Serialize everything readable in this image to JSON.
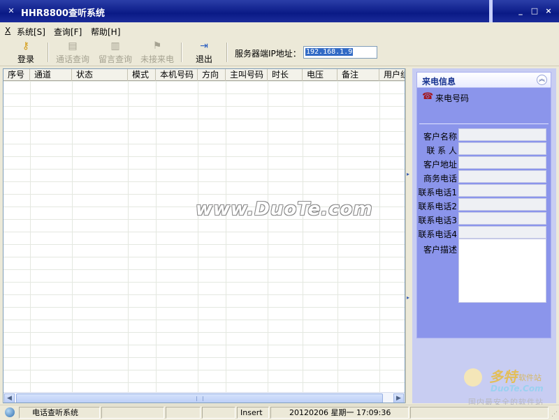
{
  "window": {
    "title": "HHR8800查听系统",
    "controls": {
      "minimize": "_",
      "maximize": "□",
      "close": "×"
    }
  },
  "menu": {
    "items": [
      {
        "label": "X"
      },
      {
        "label": "系统[S]"
      },
      {
        "label": "查询[F]"
      },
      {
        "label": "帮助[H]"
      }
    ]
  },
  "toolbar": {
    "login": "登录",
    "call_query": "通话查询",
    "message_query": "留言查询",
    "missed_calls": "未接来电",
    "exit": "退出",
    "server_ip_label": "服务器端IP地址：",
    "server_ip_value": "192.168.1.9"
  },
  "table": {
    "columns": [
      "序号",
      "通道",
      "状态",
      "模式",
      "本机号码",
      "方向",
      "主叫号码",
      "时长",
      "电压",
      "备注",
      "用户组"
    ]
  },
  "watermark": "www.DuoTe.com",
  "caller_panel": {
    "title": "来电信息",
    "caller_number_label": "来电号码",
    "fields": {
      "customer_name": "客户名称",
      "contact_person": "联 系 人",
      "customer_address": "客户地址",
      "business_phone": "商务电话",
      "contact_phone_1": "联系电话1",
      "contact_phone_2": "联系电话2",
      "contact_phone_3": "联系电话3",
      "contact_phone_4": "联系电话4",
      "customer_description": "客户描述"
    }
  },
  "logo": {
    "brand": "多特",
    "suffix": "软件站",
    "domain": "DuoTe.Com",
    "tagline": "国内最安全的软件站"
  },
  "statusbar": {
    "app_name": "电话查听系统",
    "mode": "Insert",
    "date_time": "20120206 星期一 17:09:36"
  },
  "colors": {
    "title_bar": "#0a1a86",
    "panel": "#8b95eb",
    "panel_title": "#15318f"
  }
}
